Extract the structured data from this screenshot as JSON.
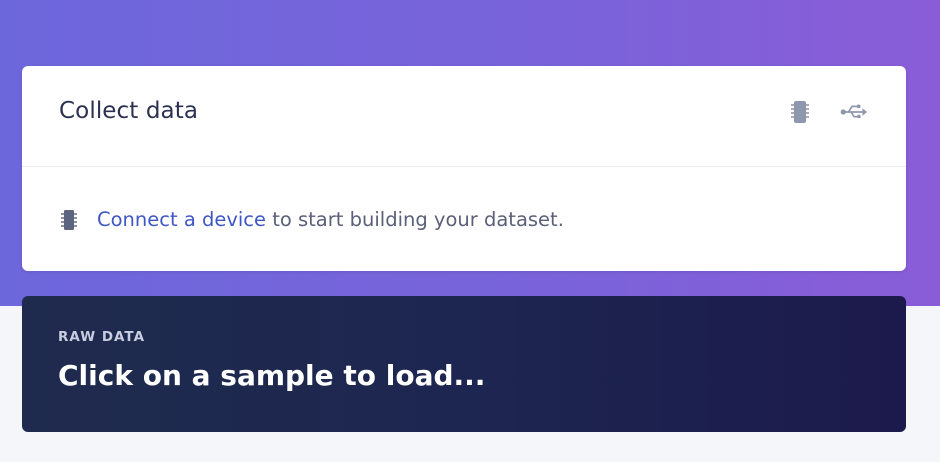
{
  "collect": {
    "title": "Collect data",
    "icons": [
      "chip-icon",
      "usb-icon"
    ],
    "connect_link": "Connect a device",
    "connect_rest": " to start building your dataset."
  },
  "raw": {
    "label": "RAW DATA",
    "title": "Click on a sample to load..."
  },
  "colors": {
    "hero": "#7465dc",
    "link": "#3f57c6",
    "raw_bg": "#1e2550"
  }
}
